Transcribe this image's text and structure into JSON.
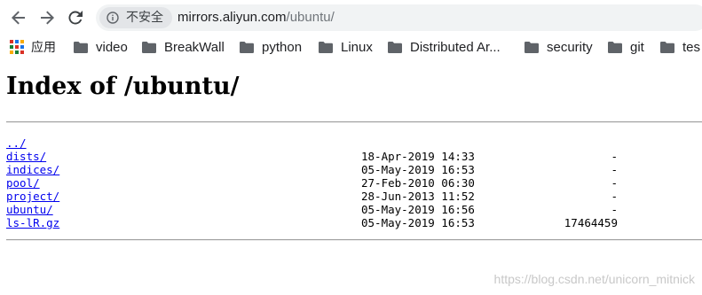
{
  "browser": {
    "nav": {
      "back_icon": "arrow-left-icon",
      "forward_icon": "arrow-right-icon",
      "reload_icon": "reload-icon"
    },
    "address_bar": {
      "security_icon": "info-circle-icon",
      "security_label": "不安全",
      "url_host": "mirrors.aliyun.com",
      "url_path": "/ubuntu/"
    }
  },
  "bookmarks": {
    "apps_label": "应用",
    "items": [
      {
        "label": "video",
        "icon": "folder-icon"
      },
      {
        "label": "BreakWall",
        "icon": "folder-icon"
      },
      {
        "label": "python",
        "icon": "folder-icon"
      },
      {
        "label": "Linux",
        "icon": "folder-icon"
      },
      {
        "label": "Distributed Ar...",
        "icon": "folder-icon"
      },
      {
        "label": "security",
        "icon": "folder-icon"
      },
      {
        "label": "git",
        "icon": "folder-icon"
      },
      {
        "label": "tes",
        "icon": "folder-icon"
      }
    ]
  },
  "page": {
    "title": "Index of /ubuntu/",
    "entries": [
      {
        "name": "../",
        "date": "",
        "size": ""
      },
      {
        "name": "dists/",
        "date": "18-Apr-2019 14:33",
        "size": "-"
      },
      {
        "name": "indices/",
        "date": "05-May-2019 16:53",
        "size": "-"
      },
      {
        "name": "pool/",
        "date": "27-Feb-2010 06:30",
        "size": "-"
      },
      {
        "name": "project/",
        "date": "28-Jun-2013 11:52",
        "size": "-"
      },
      {
        "name": "ubuntu/",
        "date": "05-May-2019 16:56",
        "size": "-"
      },
      {
        "name": "ls-lR.gz",
        "date": "05-May-2019 16:53",
        "size": "17464459"
      }
    ],
    "watermark": "https://blog.csdn.net/unicorn_mitnick"
  },
  "colors": {
    "link": "#0000ee",
    "omnibox_bg": "#f1f3f4",
    "icon_gray": "#5f6368",
    "folder": "#5f6368"
  }
}
